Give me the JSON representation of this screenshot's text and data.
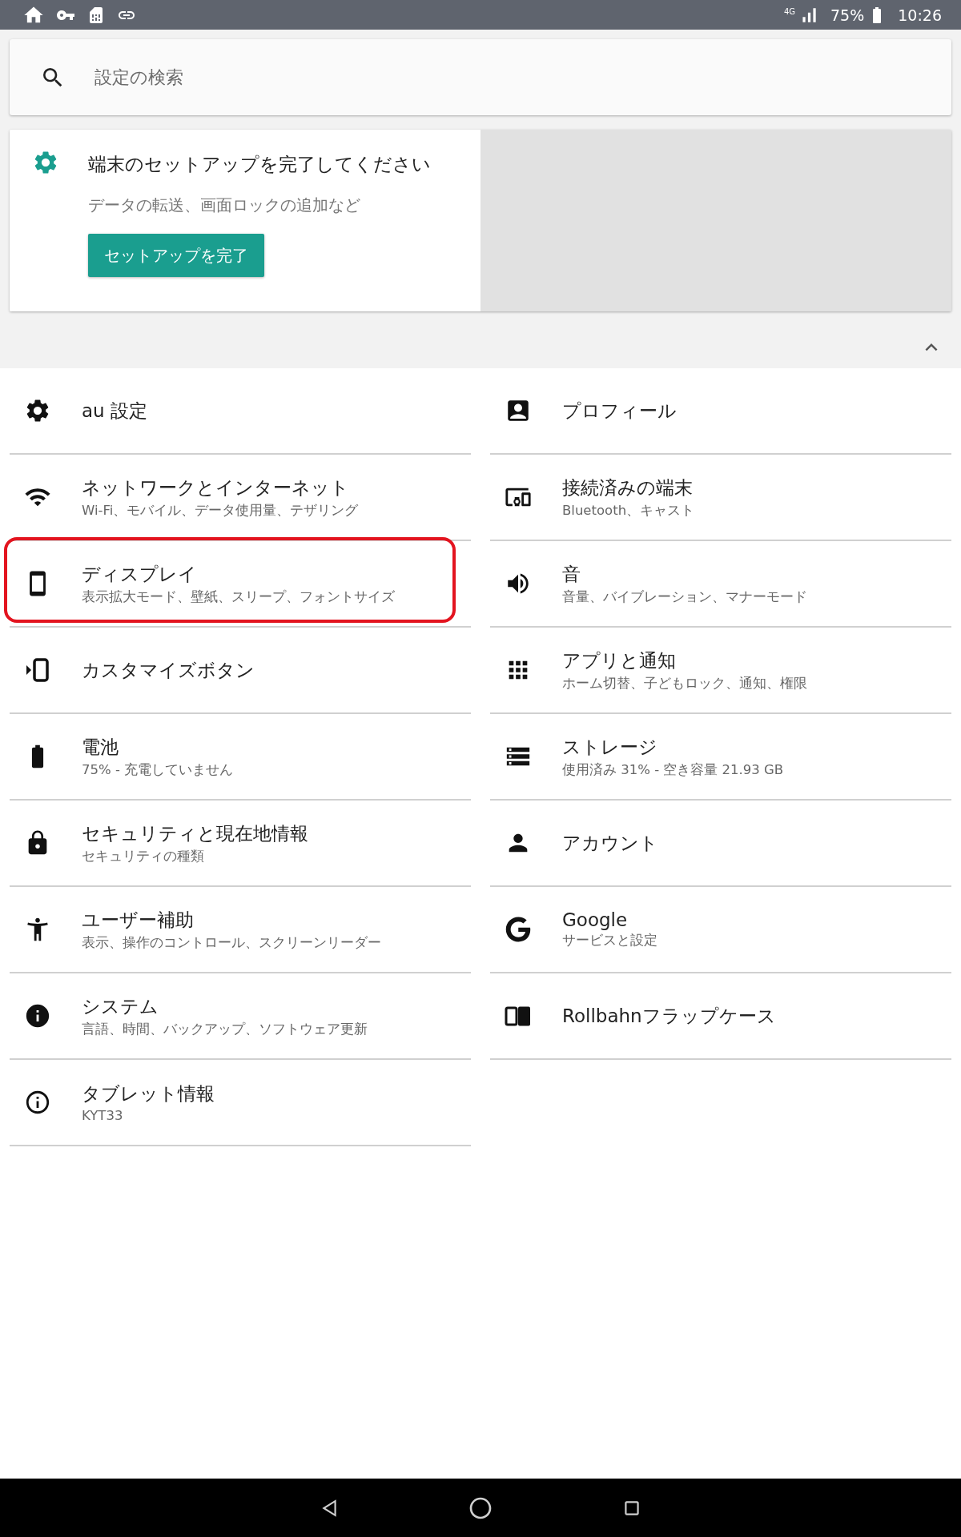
{
  "status_bar": {
    "network": "4G",
    "battery": "75%",
    "time": "10:26"
  },
  "search": {
    "placeholder": "設定の検索"
  },
  "setup_card": {
    "title": "端末のセットアップを完了してください",
    "subtitle": "データの転送、画面ロックの追加など",
    "button": "セットアップを完了",
    "expanded": true
  },
  "left_items": [
    {
      "title": "au 設定",
      "highlighted": false
    },
    {
      "title": "ネットワークとインターネット",
      "subtitle": "Wi-Fi、モバイル、データ使用量、テザリング",
      "highlighted": false
    },
    {
      "title": "ディスプレイ",
      "subtitle": "表示拡大モード、壁紙、スリープ、フォントサイズ",
      "highlighted": true
    },
    {
      "title": "カスタマイズボタン",
      "highlighted": false
    },
    {
      "title": "電池",
      "subtitle": "75% - 充電していません",
      "highlighted": false
    },
    {
      "title": "セキュリティと現在地情報",
      "subtitle": "セキュリティの種類",
      "highlighted": false
    },
    {
      "title": "ユーザー補助",
      "subtitle": "表示、操作のコントロール、スクリーンリーダー",
      "highlighted": false
    },
    {
      "title": "システム",
      "subtitle": "言語、時間、バックアップ、ソフトウェア更新",
      "highlighted": false
    },
    {
      "title": "タブレット情報",
      "subtitle": "KYT33",
      "highlighted": false
    }
  ],
  "right_items": [
    {
      "title": "プロフィール",
      "highlighted": false
    },
    {
      "title": "接続済みの端末",
      "subtitle": "Bluetooth、キャスト",
      "highlighted": false
    },
    {
      "title": "音",
      "subtitle": "音量、バイブレーション、マナーモード",
      "highlighted": false
    },
    {
      "title": "アプリと通知",
      "subtitle": "ホーム切替、子どもロック、通知、権限",
      "highlighted": false
    },
    {
      "title": "ストレージ",
      "subtitle": "使用済み 31% - 空き容量 21.93 GB",
      "highlighted": false
    },
    {
      "title": "アカウント",
      "highlighted": false
    },
    {
      "title": "Google",
      "subtitle": "サービスと設定",
      "highlighted": false
    },
    {
      "title": "Rollbahnフラップケース",
      "highlighted": false
    }
  ]
}
